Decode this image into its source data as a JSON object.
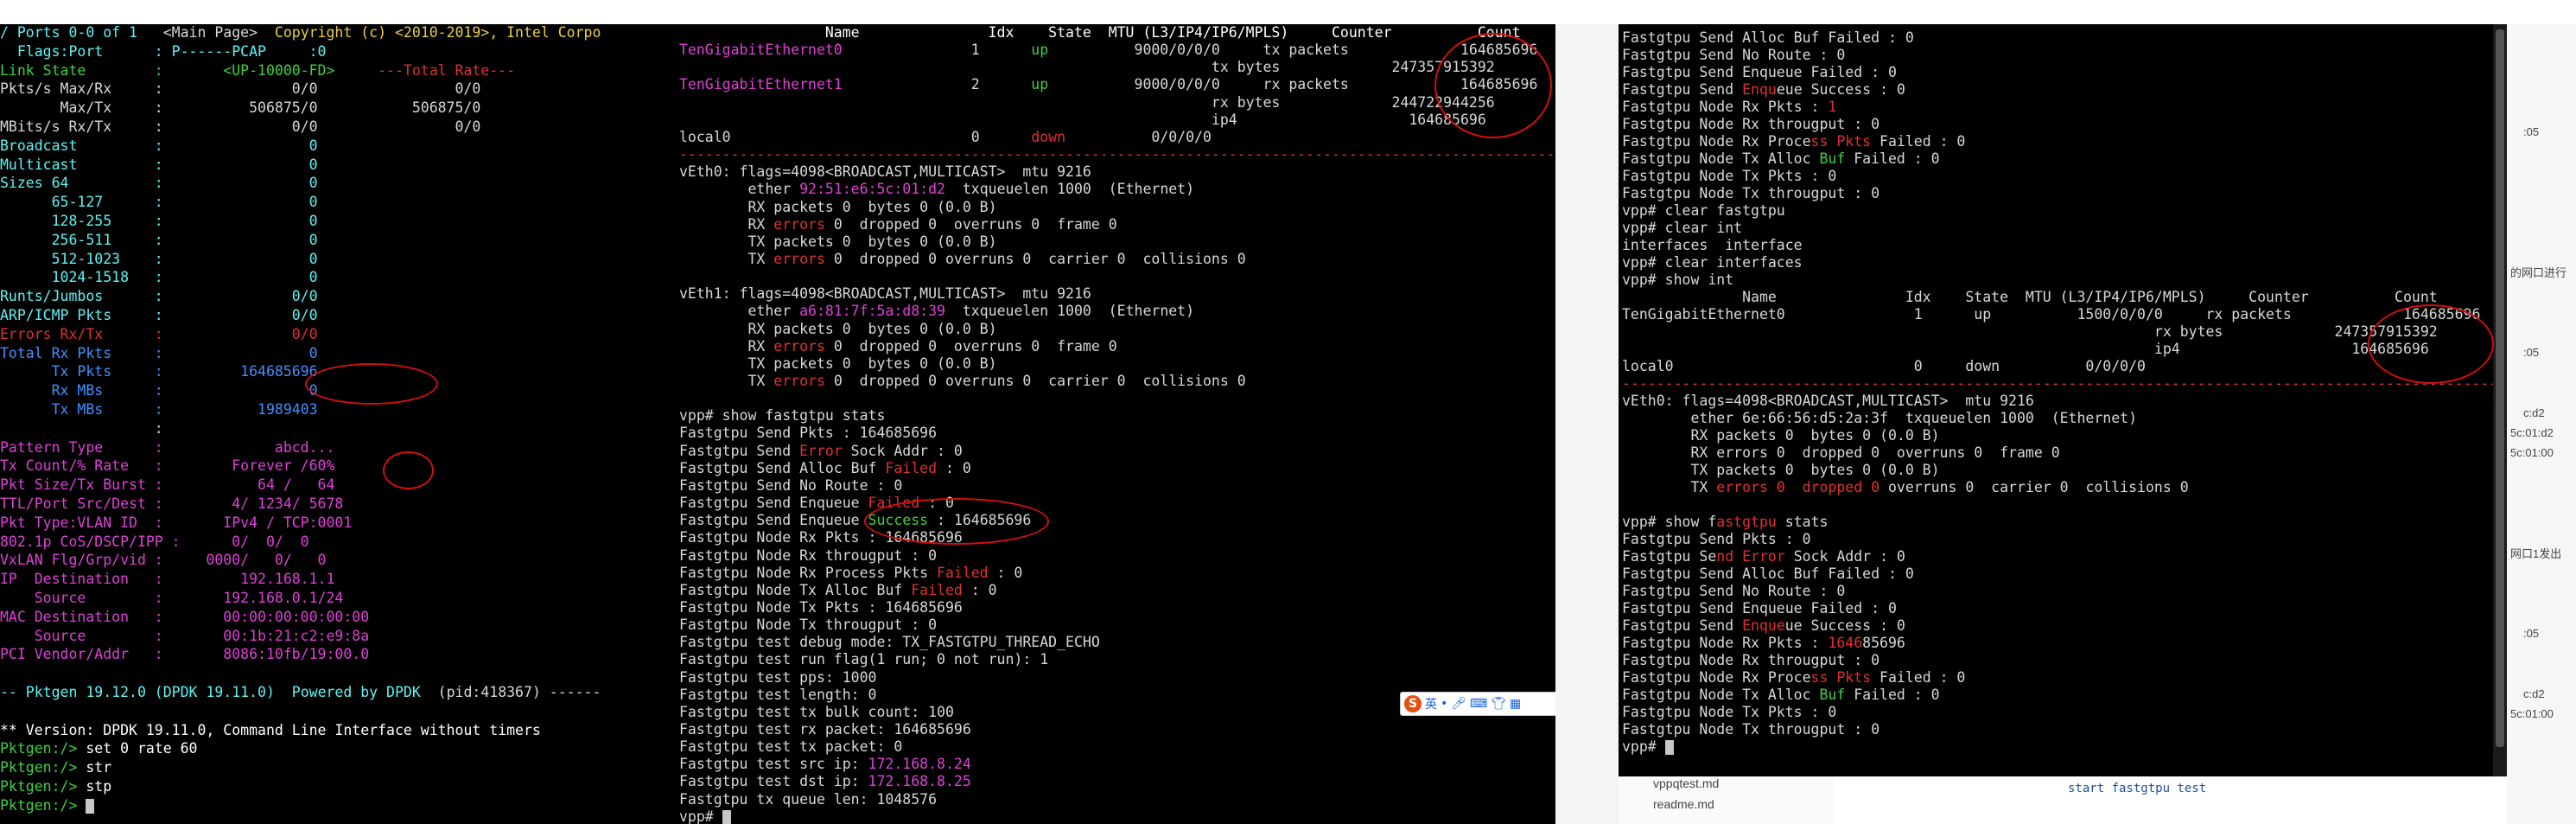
{
  "pktgen": {
    "lines": [
      [
        {
          "t": "/ Ports 0-0 of 1   ",
          "c": "c"
        },
        {
          "t": "<Main Page>  ",
          "c": "w"
        },
        {
          "t": "Copyright (c) <2010-2019>, Intel Corpo",
          "c": "y"
        }
      ],
      [
        {
          "t": "  Flags:Port      : P------PCAP     :0",
          "c": "c"
        }
      ],
      [
        {
          "t": "Link State        :       ",
          "c": "g"
        },
        {
          "t": "<UP-10000-FD>",
          "c": "g"
        },
        {
          "t": "     ---Total Rate---",
          "c": "r"
        }
      ],
      [
        {
          "t": "Pkts/s Max/Rx     :               0/0                0/0",
          "c": "w"
        }
      ],
      [
        {
          "t": "       Max/Tx     :          506875/0           506875/0",
          "c": "w"
        }
      ],
      [
        {
          "t": "MBits/s Rx/Tx     :               0/0                0/0",
          "c": "w"
        }
      ],
      [
        {
          "t": "Broadcast         :                 0",
          "c": "c"
        }
      ],
      [
        {
          "t": "Multicast         :                 0",
          "c": "c"
        }
      ],
      [
        {
          "t": "Sizes 64          :                 0",
          "c": "c"
        }
      ],
      [
        {
          "t": "      65-127      :                 0",
          "c": "c"
        }
      ],
      [
        {
          "t": "      128-255     :                 0",
          "c": "c"
        }
      ],
      [
        {
          "t": "      256-511     :                 0",
          "c": "c"
        }
      ],
      [
        {
          "t": "      512-1023    :                 0",
          "c": "c"
        }
      ],
      [
        {
          "t": "      1024-1518   :                 0",
          "c": "c"
        }
      ],
      [
        {
          "t": "Runts/Jumbos      :               0/0",
          "c": "c"
        }
      ],
      [
        {
          "t": "ARP/ICMP Pkts     :               0/0",
          "c": "c"
        }
      ],
      [
        {
          "t": "Errors Rx/Tx      :               0/0",
          "c": "r"
        }
      ],
      [
        {
          "t": "Total Rx Pkts     :                 0",
          "c": "b"
        }
      ],
      [
        {
          "t": "      Tx Pkts     :         164685696",
          "c": "b"
        }
      ],
      [
        {
          "t": "      Rx MBs      :                 0",
          "c": "b"
        }
      ],
      [
        {
          "t": "      Tx MBs      :           1989403",
          "c": "b"
        }
      ],
      [
        {
          "t": "                  :",
          "c": "w"
        }
      ],
      [
        {
          "t": "Pattern Type      :             abcd...",
          "c": "m"
        }
      ],
      [
        {
          "t": "Tx Count/% Rate   :        Forever /60%",
          "c": "m"
        }
      ],
      [
        {
          "t": "Pkt Size/Tx Burst :           64 /   64",
          "c": "m"
        }
      ],
      [
        {
          "t": "TTL/Port Src/Dest :        4/ 1234/ 5678",
          "c": "m"
        }
      ],
      [
        {
          "t": "Pkt Type:VLAN ID  :       IPv4 / TCP:0001",
          "c": "m"
        }
      ],
      [
        {
          "t": "802.1p CoS/DSCP/IPP :      0/  0/  0",
          "c": "m"
        }
      ],
      [
        {
          "t": "VxLAN Flg/Grp/vid :     0000/   0/   0",
          "c": "m"
        }
      ],
      [
        {
          "t": "IP  Destination   :         192.168.1.1",
          "c": "m"
        }
      ],
      [
        {
          "t": "    Source        :       192.168.0.1/24",
          "c": "m"
        }
      ],
      [
        {
          "t": "MAC Destination   :       00:00:00:00:00:00",
          "c": "m"
        }
      ],
      [
        {
          "t": "    Source        :       00:1b:21:c2:e9:8a",
          "c": "m"
        }
      ],
      [
        {
          "t": "PCI Vendor/Addr   :       8086:10fb/19:00.0",
          "c": "m"
        }
      ],
      [
        {
          "t": "",
          "c": "w"
        }
      ],
      [
        {
          "t": "-- Pktgen 19.12.0 (DPDK 19.11.0)  ",
          "c": "c"
        },
        {
          "t": "Powered by DPDK  ",
          "c": "c"
        },
        {
          "t": "(pid:418367) ------",
          "c": "w"
        }
      ],
      [
        {
          "t": "",
          "c": "w"
        }
      ],
      [
        {
          "t": "** Version: DPDK 19.11.0, Command Line Interface without timers",
          "c": "bw"
        }
      ],
      [
        {
          "t": "Pktgen:/> ",
          "c": "g"
        },
        {
          "t": "set 0 rate 60",
          "c": "bw"
        }
      ],
      [
        {
          "t": "Pktgen:/> ",
          "c": "g"
        },
        {
          "t": "str",
          "c": "bw"
        }
      ],
      [
        {
          "t": "Pktgen:/> ",
          "c": "g"
        },
        {
          "t": "stp",
          "c": "bw"
        }
      ],
      [
        {
          "t": "Pktgen:/> ",
          "c": "g"
        },
        {
          "t": "",
          "c": "bw",
          "cursor": true
        }
      ]
    ]
  },
  "vpp_left": {
    "lines": [
      [
        {
          "t": "                 Name               Idx    State  MTU (L3/IP4/IP6/MPLS)     Counter          Count",
          "c": "bw"
        }
      ],
      [
        {
          "t": "TenGigabitEthernet0",
          "c": "m"
        },
        {
          "t": "               1      ",
          "c": "w"
        },
        {
          "t": "up",
          "c": "g"
        },
        {
          "t": "          9000/0/0/0     tx packets             164685696",
          "c": "w"
        }
      ],
      [
        {
          "t": "                                                              tx bytes             247357915392",
          "c": "w"
        }
      ],
      [
        {
          "t": "TenGigabitEthernet1",
          "c": "m"
        },
        {
          "t": "               2      ",
          "c": "w"
        },
        {
          "t": "up",
          "c": "g"
        },
        {
          "t": "          9000/0/0/0     rx packets             164685696",
          "c": "w"
        }
      ],
      [
        {
          "t": "                                                              rx bytes             244722944256",
          "c": "w"
        }
      ],
      [
        {
          "t": "                                                              ip4                    164685696",
          "c": "w"
        }
      ],
      [
        {
          "t": "local0                            0      ",
          "c": "w"
        },
        {
          "t": "down",
          "c": "r"
        },
        {
          "t": "          0/0/0/0",
          "c": "w"
        }
      ],
      [
        {
          "t": "---------------------------------------------------------------------------------------------------------",
          "c": "r"
        }
      ],
      [
        {
          "t": "vEth0: flags=4098<BROADCAST,MULTICAST>  mtu 9216",
          "c": "w"
        }
      ],
      [
        {
          "t": "        ether ",
          "c": "w"
        },
        {
          "t": "92:51:e6:5c:01:d2",
          "c": "m"
        },
        {
          "t": "  txqueuelen 1000  (Ethernet)",
          "c": "w"
        }
      ],
      [
        {
          "t": "        RX packets 0  bytes 0 (0.0 B)",
          "c": "w"
        }
      ],
      [
        {
          "t": "        RX ",
          "c": "w"
        },
        {
          "t": "errors",
          "c": "r"
        },
        {
          "t": " 0  dropped 0  overruns 0  frame 0",
          "c": "w"
        }
      ],
      [
        {
          "t": "        TX packets 0  bytes 0 (0.0 B)",
          "c": "w"
        }
      ],
      [
        {
          "t": "        TX ",
          "c": "w"
        },
        {
          "t": "errors",
          "c": "r"
        },
        {
          "t": " 0  dropped 0 overruns 0  carrier 0  collisions 0",
          "c": "w"
        }
      ],
      [
        {
          "t": "",
          "c": "w"
        }
      ],
      [
        {
          "t": "vEth1: flags=4098<BROADCAST,MULTICAST>  mtu 9216",
          "c": "w"
        }
      ],
      [
        {
          "t": "        ether ",
          "c": "w"
        },
        {
          "t": "a6:81:7f:5a:d8:39",
          "c": "m"
        },
        {
          "t": "  txqueuelen 1000  (Ethernet)",
          "c": "w"
        }
      ],
      [
        {
          "t": "        RX packets 0  bytes 0 (0.0 B)",
          "c": "w"
        }
      ],
      [
        {
          "t": "        RX ",
          "c": "w"
        },
        {
          "t": "errors",
          "c": "r"
        },
        {
          "t": " 0  dropped 0  overruns 0  frame 0",
          "c": "w"
        }
      ],
      [
        {
          "t": "        TX packets 0  bytes 0 (0.0 B)",
          "c": "w"
        }
      ],
      [
        {
          "t": "        TX ",
          "c": "w"
        },
        {
          "t": "errors",
          "c": "r"
        },
        {
          "t": " 0  dropped 0 overruns 0  carrier 0  collisions 0",
          "c": "w"
        }
      ],
      [
        {
          "t": "",
          "c": "w"
        }
      ],
      [
        {
          "t": "vpp# show fastgtpu stats",
          "c": "w"
        }
      ],
      [
        {
          "t": "Fastgtpu Send Pkts : 164685696",
          "c": "w"
        }
      ],
      [
        {
          "t": "Fastgtpu Send ",
          "c": "w"
        },
        {
          "t": "Error",
          "c": "r"
        },
        {
          "t": " Sock Addr : 0",
          "c": "w"
        }
      ],
      [
        {
          "t": "Fastgtpu Send Alloc Buf ",
          "c": "w"
        },
        {
          "t": "Failed",
          "c": "r"
        },
        {
          "t": " : 0",
          "c": "w"
        }
      ],
      [
        {
          "t": "Fastgtpu Send No Route : 0",
          "c": "w"
        }
      ],
      [
        {
          "t": "Fastgtpu Send Enqueue ",
          "c": "w"
        },
        {
          "t": "Failed",
          "c": "r"
        },
        {
          "t": " : 0",
          "c": "w"
        }
      ],
      [
        {
          "t": "Fastgtpu Send Enqueue ",
          "c": "w"
        },
        {
          "t": "Success",
          "c": "g"
        },
        {
          "t": " : 164685696",
          "c": "w"
        }
      ],
      [
        {
          "t": "Fastgtpu Node Rx Pkts : 164685696",
          "c": "w"
        }
      ],
      [
        {
          "t": "Fastgtpu Node Rx througput : 0",
          "c": "w"
        }
      ],
      [
        {
          "t": "Fastgtpu Node Rx Process Pkts ",
          "c": "w"
        },
        {
          "t": "Failed",
          "c": "r"
        },
        {
          "t": " : 0",
          "c": "w"
        }
      ],
      [
        {
          "t": "Fastgtpu Node Tx Alloc Buf ",
          "c": "w"
        },
        {
          "t": "Failed",
          "c": "r"
        },
        {
          "t": " : 0",
          "c": "w"
        }
      ],
      [
        {
          "t": "Fastgtpu Node Tx Pkts : 164685696",
          "c": "w"
        }
      ],
      [
        {
          "t": "Fastgtpu Node Tx througput : 0",
          "c": "w"
        }
      ],
      [
        {
          "t": "Fastgtpu test debug mode: TX_FASTGTPU_THREAD_ECHO",
          "c": "w"
        }
      ],
      [
        {
          "t": "Fastgtpu test run flag(1 run; 0 not run): 1",
          "c": "w"
        }
      ],
      [
        {
          "t": "Fastgtpu test pps: 1000",
          "c": "w"
        }
      ],
      [
        {
          "t": "Fastgtpu test length: 0",
          "c": "w"
        }
      ],
      [
        {
          "t": "Fastgtpu test tx bulk count: 100",
          "c": "w"
        }
      ],
      [
        {
          "t": "Fastgtpu test rx packet: 164685696",
          "c": "w"
        }
      ],
      [
        {
          "t": "Fastgtpu test tx packet: 0",
          "c": "w"
        }
      ],
      [
        {
          "t": "Fastgtpu test src ip: ",
          "c": "w"
        },
        {
          "t": "172.168.8.24",
          "c": "m"
        }
      ],
      [
        {
          "t": "Fastgtpu test dst ip: ",
          "c": "w"
        },
        {
          "t": "172.168.8.25",
          "c": "m"
        }
      ],
      [
        {
          "t": "Fastgtpu tx queue len: 1048576",
          "c": "w"
        }
      ],
      [
        {
          "t": "vpp# ",
          "c": "w"
        },
        {
          "t": "",
          "c": "w",
          "cursor": true
        }
      ]
    ]
  },
  "vpp_right": {
    "lines": [
      [
        {
          "t": "Fastgtpu Send Alloc Buf Failed : 0",
          "c": "w"
        }
      ],
      [
        {
          "t": "Fastgtpu Send No Route : 0",
          "c": "w"
        }
      ],
      [
        {
          "t": "Fastgtpu Send Enqueue Failed : 0",
          "c": "w"
        }
      ],
      [
        {
          "t": "Fastgtpu Send ",
          "c": "w"
        },
        {
          "t": "Enqu",
          "c": "r"
        },
        {
          "t": "eue Success : 0",
          "c": "w"
        }
      ],
      [
        {
          "t": "Fastgtpu Node Rx Pkts : ",
          "c": "w"
        },
        {
          "t": "1",
          "c": "r"
        }
      ],
      [
        {
          "t": "Fastgtpu Node Rx througput : 0",
          "c": "w"
        }
      ],
      [
        {
          "t": "Fastgtpu Node Rx Proce",
          "c": "w"
        },
        {
          "t": "ss Pkts",
          "c": "r"
        },
        {
          "t": " Failed : 0",
          "c": "w"
        }
      ],
      [
        {
          "t": "Fastgtpu Node Tx Alloc ",
          "c": "w"
        },
        {
          "t": "Buf",
          "c": "g"
        },
        {
          "t": " Failed : 0",
          "c": "w"
        }
      ],
      [
        {
          "t": "Fastgtpu Node Tx Pkts : 0",
          "c": "w"
        }
      ],
      [
        {
          "t": "Fastgtpu Node Tx througput : 0",
          "c": "w"
        }
      ],
      [
        {
          "t": "vpp# clear fastgtpu",
          "c": "w"
        }
      ],
      [
        {
          "t": "vpp# clear int",
          "c": "w"
        }
      ],
      [
        {
          "t": "interfaces  interface",
          "c": "w"
        }
      ],
      [
        {
          "t": "vpp# clear interfaces",
          "c": "w"
        }
      ],
      [
        {
          "t": "vpp# show int",
          "c": "w"
        }
      ],
      [
        {
          "t": "              Name               Idx    State  MTU (L3/IP4/IP6/MPLS)     Counter          Count",
          "c": "w"
        }
      ],
      [
        {
          "t": "TenGigabitEthernet0               1      up          1500/0/0/0     rx packets             164685696",
          "c": "w"
        }
      ],
      [
        {
          "t": "                                                              rx bytes             247357915392",
          "c": "w"
        }
      ],
      [
        {
          "t": "                                                              ip4                    164685696",
          "c": "w"
        }
      ],
      [
        {
          "t": "local0                            0     down          0/0/0/0",
          "c": "w"
        }
      ],
      [
        {
          "t": "---------------------------------------------------------------------------------------------------------",
          "c": "r"
        }
      ],
      [
        {
          "t": "vEth0: flags=4098<BROADCAST,MULTICAST>  mtu 9216",
          "c": "w"
        }
      ],
      [
        {
          "t": "        ether 6e:66:56:d5:2a:3f  txqueuelen 1000  (Ethernet)",
          "c": "w"
        }
      ],
      [
        {
          "t": "        RX packets 0  bytes 0 (0.0 B)",
          "c": "w"
        }
      ],
      [
        {
          "t": "        RX errors 0  dropped 0  overruns 0  frame 0",
          "c": "w"
        }
      ],
      [
        {
          "t": "        TX packets 0  bytes 0 (0.0 B)",
          "c": "w"
        }
      ],
      [
        {
          "t": "        TX ",
          "c": "w"
        },
        {
          "t": "errors 0  dropped 0",
          "c": "r"
        },
        {
          "t": " overruns 0  carrier 0  collisions 0",
          "c": "w"
        }
      ],
      [
        {
          "t": "",
          "c": "w"
        }
      ],
      [
        {
          "t": "vpp# show f",
          "c": "w"
        },
        {
          "t": "astgtpu",
          "c": "r"
        },
        {
          "t": " stats",
          "c": "w"
        }
      ],
      [
        {
          "t": "Fastgtpu Send Pkts : 0",
          "c": "w"
        }
      ],
      [
        {
          "t": "Fastgtpu Se",
          "c": "w"
        },
        {
          "t": "nd Error",
          "c": "r"
        },
        {
          "t": " Sock Addr : 0",
          "c": "w"
        }
      ],
      [
        {
          "t": "Fastgtpu Send Alloc Buf Failed : 0",
          "c": "w"
        }
      ],
      [
        {
          "t": "Fastgtpu Send No Route : 0",
          "c": "w"
        }
      ],
      [
        {
          "t": "Fastgtpu Send Enqueue Failed : 0",
          "c": "w"
        }
      ],
      [
        {
          "t": "Fastgtpu Send ",
          "c": "w"
        },
        {
          "t": "Enque",
          "c": "r"
        },
        {
          "t": "ue Success : 0",
          "c": "w"
        }
      ],
      [
        {
          "t": "Fastgtpu Node Rx Pkts : ",
          "c": "w"
        },
        {
          "t": "1646",
          "c": "r"
        },
        {
          "t": "85696",
          "c": "w"
        }
      ],
      [
        {
          "t": "Fastgtpu Node Rx througput : 0",
          "c": "w"
        }
      ],
      [
        {
          "t": "Fastgtpu Node Rx Proce",
          "c": "w"
        },
        {
          "t": "ss Pkts",
          "c": "r"
        },
        {
          "t": " Failed : 0",
          "c": "w"
        }
      ],
      [
        {
          "t": "Fastgtpu Node Tx Alloc ",
          "c": "w"
        },
        {
          "t": "Buf",
          "c": "g"
        },
        {
          "t": " Failed : 0",
          "c": "w"
        }
      ],
      [
        {
          "t": "Fastgtpu Node Tx Pkts : 0",
          "c": "w"
        }
      ],
      [
        {
          "t": "Fastgtpu Node Tx througput : 0",
          "c": "w"
        }
      ],
      [
        {
          "t": "vpp# ",
          "c": "w"
        },
        {
          "t": "",
          "c": "w",
          "cursor": true
        }
      ]
    ]
  },
  "side_panel": {
    "snippets": [
      ":05",
      "的网口进行",
      ":05",
      "c:d2",
      "5c:01:d2",
      "5c:01:00",
      "网口1发出",
      ":05",
      "c:d2",
      "5c:01:00"
    ],
    "files": [
      "vppqtest.md",
      "readme.md"
    ],
    "command": "start fastgtpu test"
  },
  "ime_toolbar": {
    "logo": "S",
    "lang": "英"
  }
}
